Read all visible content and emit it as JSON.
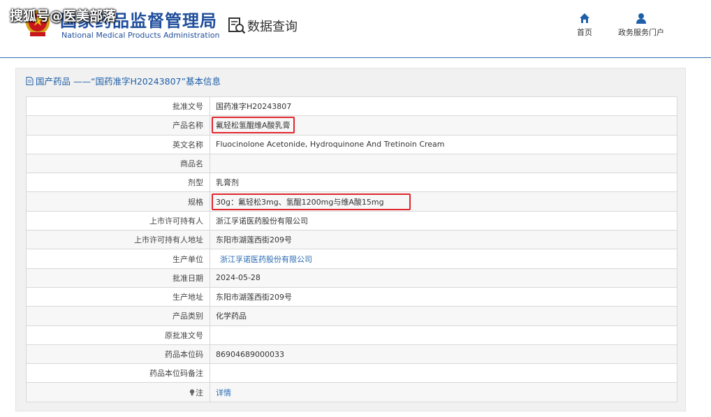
{
  "header": {
    "agency_cn": "国家药品监督管理局",
    "agency_en": "National Medical Products Administration",
    "watermark": "搜狐号@医美部落",
    "query_label": "数据查询",
    "nav": {
      "home_label": "首页",
      "portal_label": "政务服务门户"
    }
  },
  "panel": {
    "title": "国产药品 ——“国药准字H20243807”基本信息"
  },
  "fields": [
    {
      "label": "批准文号",
      "value": "国药准字H20243807"
    },
    {
      "label": "产品名称",
      "value": "氟轻松氢醌维A酸乳膏"
    },
    {
      "label": "英文名称",
      "value": "Fluocinolone Acetonide, Hydroquinone And Tretinoin Cream"
    },
    {
      "label": "商品名",
      "value": ""
    },
    {
      "label": "剂型",
      "value": "乳膏剂"
    },
    {
      "label": "规格",
      "value": "30g：氟轻松3mg、氢醌1200mg与维A酸15mg"
    },
    {
      "label": "上市许可持有人",
      "value": "浙江孚诺医药股份有限公司"
    },
    {
      "label": "上市许可持有人地址",
      "value": "东阳市湖莲西街209号"
    },
    {
      "label": "生产单位",
      "value": "浙江孚诺医药股份有限公司"
    },
    {
      "label": "批准日期",
      "value": "2024-05-28"
    },
    {
      "label": "生产地址",
      "value": "东阳市湖莲西街209号"
    },
    {
      "label": "产品类别",
      "value": "化学药品"
    },
    {
      "label": "原批准文号",
      "value": ""
    },
    {
      "label": "药品本位码",
      "value": "86904689000033"
    },
    {
      "label": "药品本位码备注",
      "value": ""
    },
    {
      "label": "注",
      "value": "详情"
    }
  ],
  "colors": {
    "brand_blue": "#1f4e9c",
    "link_blue": "#2a6bb3",
    "highlight_red": "#e0262c"
  },
  "icons": {
    "emblem": "national-emblem-icon",
    "query": "document-search-icon",
    "home": "home-icon",
    "portal": "user-icon",
    "title": "document-icon",
    "note": "lightbulb-icon"
  }
}
